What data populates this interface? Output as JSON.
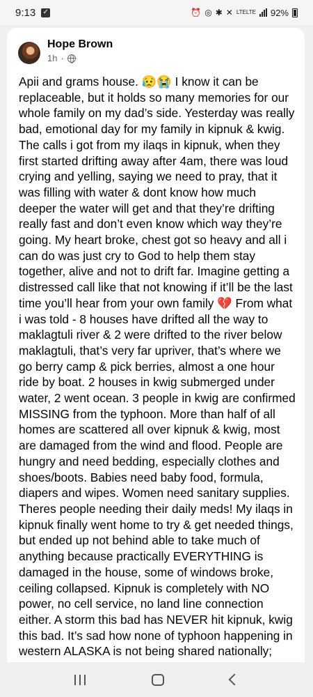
{
  "status_bar": {
    "time": "9:13",
    "network": "LTE",
    "network_sub": "LTE",
    "battery": "92%"
  },
  "post": {
    "author": "Hope Brown",
    "time": "1h",
    "separator": "·",
    "text": "Apii and grams house. 😥😭 I know it can be replaceable, but it holds so many memories for our whole family on my dad’s side. Yesterday was really bad, emotional day for my family in kipnuk & kwig. The calls i got from my ilaqs in kipnuk, when they first started drifting away after 4am, there was loud crying and yelling, saying we need to pray, that it was filling with water & dont know how much deeper the water will get and that they’re drifting really fast and don’t even know which way they’re going. My heart broke, chest got so heavy and all i can do was just cry to God to help them stay together, alive and not to drift far. Imagine getting a distressed call like that not knowing if it’ll be the last time you’ll hear from your own family 💔 From what i was told - 8 houses have drifted all the way to maklagtuli river & 2 were drifted to the river below maklagtuli, that’s very far upriver, that’s where we go berry camp & pick berries, almost a one hour ride by boat. 2 houses in kwig submerged under water, 2 went ocean. 3 people in kwig are confirmed MISSING from the typhoon. More than half of all homes are scattered all over kipnuk & kwig, most are damaged from the wind and flood. People are hungry and need bedding, especially clothes and shoes/boots. Babies need baby food, formula, diapers and wipes. Women need sanitary supplies. Theres people needing their daily meds! My ilaqs in kipnuk finally went home to try & get needed things, but ended up not behind able to take much of anything because practically EVERYTHING is damaged in the house, some of windows broke, ceiling collapsed. Kipnuk is completely with NO power, no cell service, no land line connection either. A storm this bad has NEVER hit kipnuk, kwig this bad. It’s sad how none of typhoon happening in western ALASKA is not being shared nationally; especially in kipnuk and kwig. So"
  }
}
